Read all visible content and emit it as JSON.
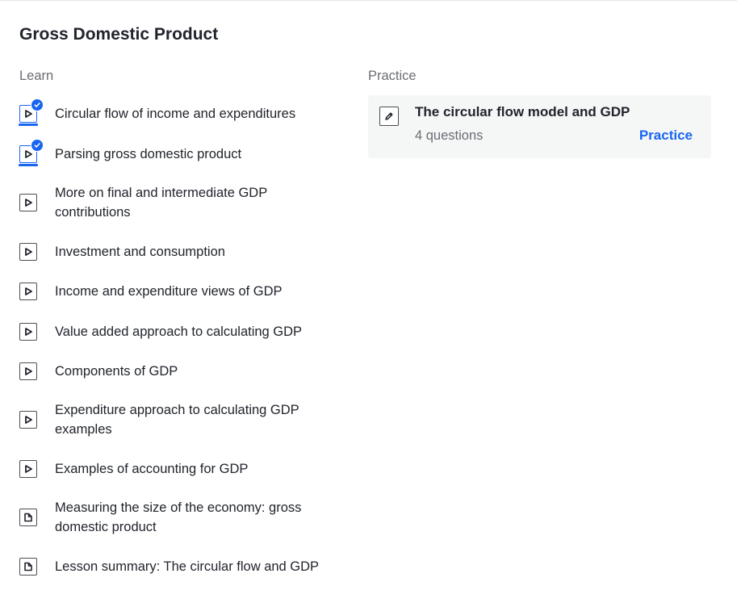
{
  "unit": {
    "title": "Gross Domestic Product"
  },
  "learn": {
    "label": "Learn",
    "items": [
      {
        "label": "Circular flow of income and expenditures",
        "type": "video",
        "icon": "play-icon",
        "completed": true
      },
      {
        "label": "Parsing gross domestic product",
        "type": "video",
        "icon": "play-icon",
        "completed": true
      },
      {
        "label": "More on final and intermediate GDP contributions",
        "type": "video",
        "icon": "play-icon",
        "completed": false
      },
      {
        "label": "Investment and consumption",
        "type": "video",
        "icon": "play-icon",
        "completed": false
      },
      {
        "label": "Income and expenditure views of GDP",
        "type": "video",
        "icon": "play-icon",
        "completed": false
      },
      {
        "label": "Value added approach to calculating GDP",
        "type": "video",
        "icon": "play-icon",
        "completed": false
      },
      {
        "label": "Components of GDP",
        "type": "video",
        "icon": "play-icon",
        "completed": false
      },
      {
        "label": "Expenditure approach to calculating GDP examples",
        "type": "video",
        "icon": "play-icon",
        "completed": false
      },
      {
        "label": "Examples of accounting for GDP",
        "type": "video",
        "icon": "play-icon",
        "completed": false
      },
      {
        "label": "Measuring the size of the economy: gross domestic product",
        "type": "article",
        "icon": "article-icon",
        "completed": false
      },
      {
        "label": "Lesson summary: The circular flow and GDP",
        "type": "article",
        "icon": "article-icon",
        "completed": false
      }
    ]
  },
  "practice": {
    "label": "Practice",
    "card": {
      "title": "The circular flow model and GDP",
      "subtitle": "4 questions",
      "action_label": "Practice",
      "icon": "pencil-icon"
    }
  },
  "colors": {
    "accent": "#1865f2",
    "text": "#21242c",
    "muted": "#6b6d73",
    "card_bg": "#f5f6f6"
  }
}
